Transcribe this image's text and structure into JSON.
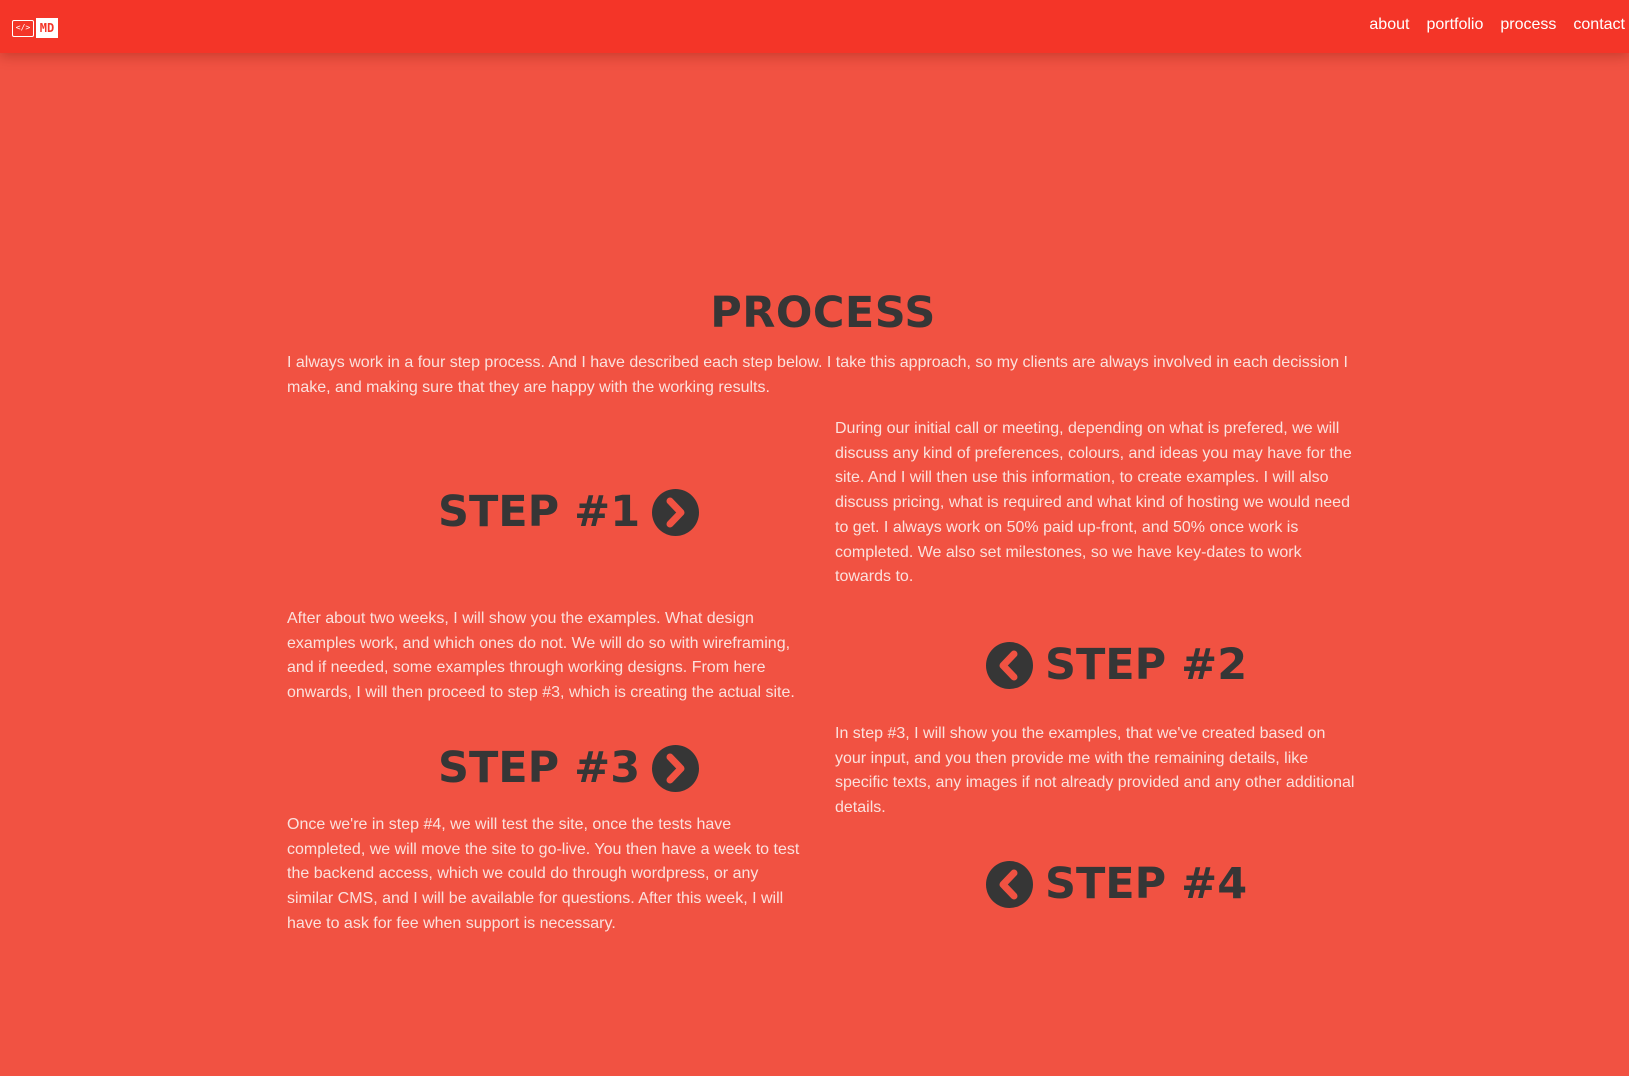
{
  "header": {
    "logo_code_text": "</>",
    "logo_text": "MD",
    "nav": [
      {
        "label": "about"
      },
      {
        "label": "portfolio"
      },
      {
        "label": "process"
      },
      {
        "label": "contact"
      }
    ]
  },
  "process": {
    "title": "PROCESS",
    "intro": "I always work in a four step process. And I have described each step below. I take this approach, so my clients are always involved in each decission I make, and making sure that they are happy with the working results.",
    "steps": [
      {
        "label": "STEP #1",
        "icon": "chevron-right-circle-icon",
        "description": "During our initial call or meeting, depending on what is prefered, we will discuss any kind of preferences, colours, and ideas you may have for the site. And I will then use this information, to create examples. I will also discuss pricing, what is required and what kind of hosting we would need to get. I always work on 50% paid up-front, and 50% once work is completed. We also set milestones, so we have key-dates to work towards to."
      },
      {
        "label": "STEP #2",
        "icon": "chevron-left-circle-icon",
        "description": "After about two weeks, I will show you the examples. What design examples work, and which ones do not. We will do so with wireframing, and if needed, some examples through working designs. From here onwards, I will then proceed to step #3, which is creating the actual site."
      },
      {
        "label": "STEP #3",
        "icon": "chevron-right-circle-icon",
        "description": "In step #3, I will show you the examples, that we've created based on your input, and you then provide me with the remaining details, like specific texts, any images if not already provided and any other additional details."
      },
      {
        "label": "STEP #4",
        "icon": "chevron-left-circle-icon",
        "description": "Once we're in step #4, we will test the site, once the tests have completed, we will move the site to go-live. You then have a week to test the backend access, which we could do through wordpress, or any similar CMS, and I will be available for questions. After this week, I will have to ask for fee when support is necessary."
      }
    ]
  },
  "colors": {
    "navbar": "#f43528",
    "background": "#f15242",
    "heading": "#363636",
    "body_text": "#fbe1dd"
  }
}
